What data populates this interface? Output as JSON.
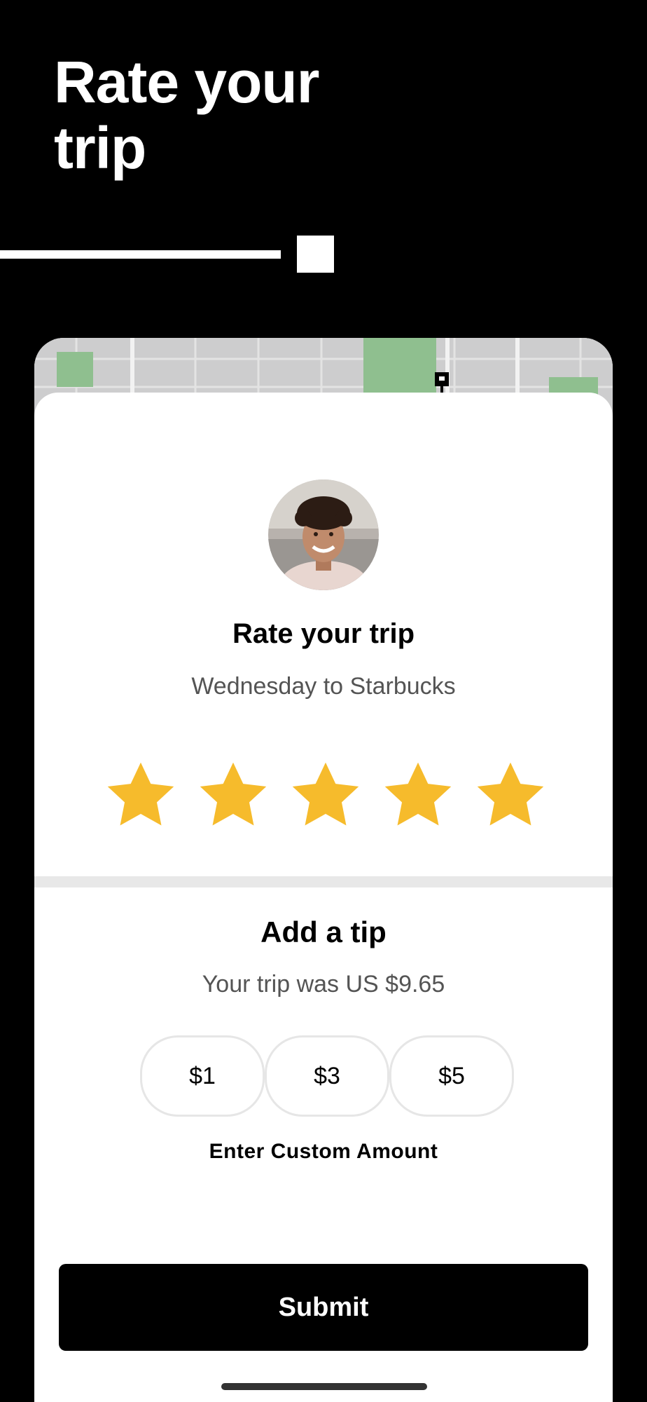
{
  "header": {
    "title": "Rate your\ntrip"
  },
  "rating": {
    "heading": "Rate your trip",
    "subtitle": "Wednesday to Starbucks",
    "stars_selected": 5,
    "stars_total": 5,
    "star_color": "#F6BB2C"
  },
  "tip": {
    "heading": "Add a tip",
    "subtitle": "Your trip was US $9.65",
    "options": [
      "$1",
      "$3",
      "$5"
    ],
    "custom_label": "Enter Custom Amount"
  },
  "actions": {
    "submit_label": "Submit"
  },
  "colors": {
    "background": "#000000",
    "sheet": "#FFFFFF",
    "map_park": "#8FBF8F"
  },
  "icons": {
    "map_pin": "map-pin-icon",
    "star": "star-icon"
  }
}
